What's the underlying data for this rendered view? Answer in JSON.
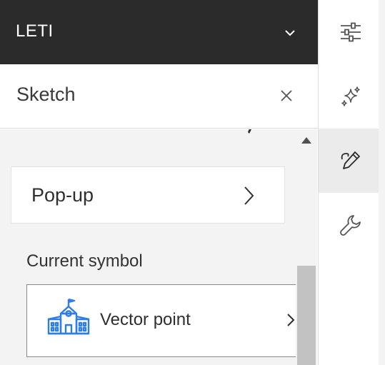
{
  "header": {
    "title": "LETI",
    "chevron_icon": "chevron-down-icon"
  },
  "panel": {
    "title": "Sketch",
    "close_icon": "close-icon"
  },
  "popup": {
    "label": "Pop-up",
    "chevron_icon": "chevron-right-icon"
  },
  "current_symbol": {
    "label": "Current symbol",
    "symbol_name": "Vector point",
    "symbol_icon": "school-building-icon",
    "symbol_color": "#2f7ee8",
    "chevron_icon": "chevron-right-icon"
  },
  "rail": {
    "items": [
      {
        "icon": "sliders-icon",
        "active": false
      },
      {
        "icon": "sparkles-icon",
        "active": false
      },
      {
        "icon": "pencil-icon",
        "active": true
      },
      {
        "icon": "wrench-icon",
        "active": false
      }
    ]
  },
  "colors": {
    "header_bg": "#2b2b2b",
    "content_bg": "#f3f3f3",
    "active_rail_bg": "#ebebeb"
  }
}
